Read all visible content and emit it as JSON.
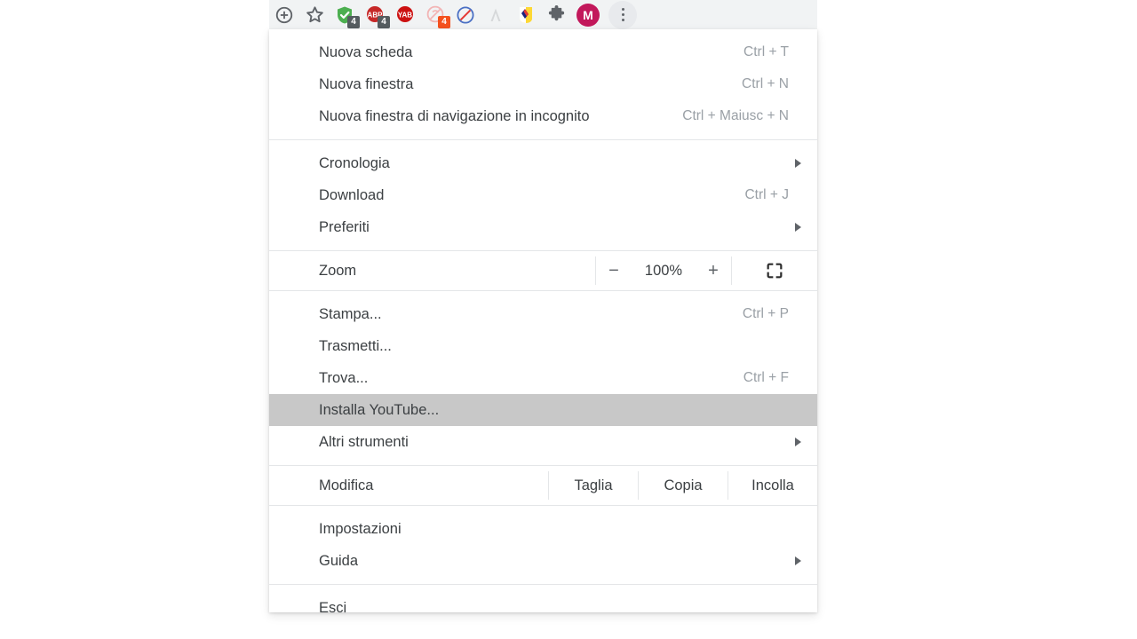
{
  "window": {
    "app": "Google Chrome",
    "locale": "it"
  },
  "toolbar": {
    "buttons": [
      {
        "name": "install-app-icon",
        "label": "Installa",
        "icon": "circle-plus-icon",
        "badge": null
      },
      {
        "name": "bookmark-star-icon",
        "label": "Aggiungi ai preferiti",
        "icon": "star-icon",
        "badge": null
      },
      {
        "name": "extension-shield-icon",
        "label": "Shield",
        "icon": "shield-check-icon",
        "badge": "4",
        "badge_color": "#555c60"
      },
      {
        "name": "extension-adblockplus-icon",
        "label": "ABP",
        "icon": "abp-icon",
        "badge": "4",
        "badge_color": "#555c60"
      },
      {
        "name": "extension-yandex-adblock-icon",
        "label": "YAB",
        "icon": "yab-icon",
        "badge": null
      },
      {
        "name": "extension-blocker-icon",
        "label": "Blocker",
        "icon": "crossed-circle-icon",
        "badge": "4",
        "badge_color": "#f4511e"
      },
      {
        "name": "extension-noscript-icon",
        "label": "NoScript",
        "icon": "no-entry-icon",
        "badge": null
      },
      {
        "name": "extension-a-icon",
        "label": "A",
        "icon": "letter-a-icon",
        "badge": null
      },
      {
        "name": "extension-colorful-icon",
        "label": "Estensione",
        "icon": "colorful-flag-icon",
        "badge": null
      },
      {
        "name": "extensions-puzzle-icon",
        "label": "Estensioni",
        "icon": "puzzle-icon",
        "badge": null
      }
    ],
    "profile": {
      "initial": "M",
      "color": "#c2185b"
    },
    "more_menu": {
      "label": "Personalizza e controlla Google Chrome",
      "icon": "three-dots-icon"
    }
  },
  "menu": {
    "groups": [
      {
        "id": "new",
        "items": [
          {
            "label": "Nuova scheda",
            "shortcut": "Ctrl + T",
            "submenu": false,
            "highlighted": false
          },
          {
            "label": "Nuova finestra",
            "shortcut": "Ctrl + N",
            "submenu": false,
            "highlighted": false
          },
          {
            "label": "Nuova finestra di navigazione in incognito",
            "shortcut": "Ctrl + Maiusc + N",
            "submenu": false,
            "highlighted": false
          }
        ]
      },
      {
        "id": "browse",
        "items": [
          {
            "label": "Cronologia",
            "shortcut": "",
            "submenu": true,
            "highlighted": false
          },
          {
            "label": "Download",
            "shortcut": "Ctrl + J",
            "submenu": false,
            "highlighted": false
          },
          {
            "label": "Preferiti",
            "shortcut": "",
            "submenu": true,
            "highlighted": false
          }
        ]
      },
      {
        "id": "page",
        "items": [
          {
            "label": "Stampa...",
            "shortcut": "Ctrl + P",
            "submenu": false,
            "highlighted": false
          },
          {
            "label": "Trasmetti...",
            "shortcut": "",
            "submenu": false,
            "highlighted": false
          },
          {
            "label": "Trova...",
            "shortcut": "Ctrl + F",
            "submenu": false,
            "highlighted": false
          },
          {
            "label": "Installa YouTube...",
            "shortcut": "",
            "submenu": false,
            "highlighted": true
          },
          {
            "label": "Altri strumenti",
            "shortcut": "",
            "submenu": true,
            "highlighted": false
          }
        ]
      },
      {
        "id": "settings",
        "items": [
          {
            "label": "Impostazioni",
            "shortcut": "",
            "submenu": false,
            "highlighted": false
          },
          {
            "label": "Guida",
            "shortcut": "",
            "submenu": true,
            "highlighted": false
          }
        ]
      },
      {
        "id": "exit",
        "items": [
          {
            "label": "Esci",
            "shortcut": "",
            "submenu": false,
            "highlighted": false
          }
        ]
      }
    ],
    "zoom_row": {
      "label": "Zoom",
      "minus": "−",
      "value": "100%",
      "plus": "+",
      "fullscreen_icon": "fullscreen-icon"
    },
    "edit_row": {
      "label": "Modifica",
      "cut": "Taglia",
      "copy": "Copia",
      "paste": "Incolla"
    }
  },
  "colors": {
    "highlight": "#c8c8c8",
    "text": "#3c4043",
    "muted": "#9aa0a6",
    "separator": "#e4e6e8",
    "toolbar_bg": "#f1f3f4"
  }
}
